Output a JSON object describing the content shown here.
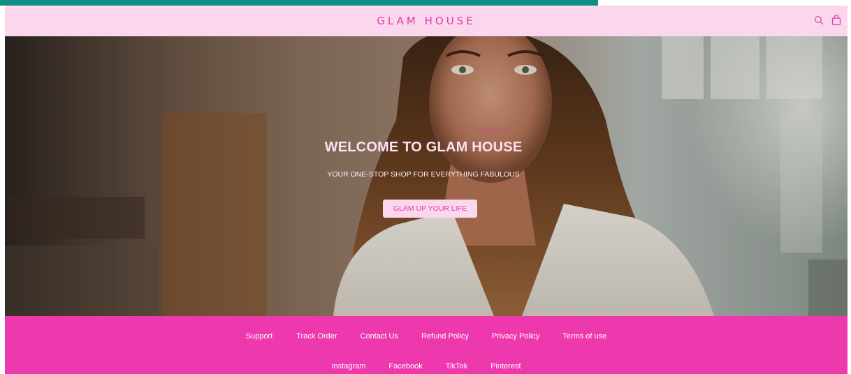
{
  "header": {
    "logo": "GLAM HOUSE",
    "icons": [
      "search-icon",
      "shopping-bag-icon"
    ]
  },
  "hero": {
    "title": "WELCOME TO GLAM HOUSE",
    "subtitle": "YOUR ONE-STOP SHOP FOR EVERYTHING FABULOUS",
    "cta_label": "GLAM UP YOUR LIFE"
  },
  "footer": {
    "links": [
      "Support",
      "Track Order",
      "Contact Us",
      "Refund Policy",
      "Privacy Policy",
      "Terms of use"
    ],
    "social": [
      "Instagram",
      "Facebook",
      "TikTok",
      "Pinterest"
    ]
  },
  "colors": {
    "header_bg": "#fbd7ee",
    "brand_pink": "#e23aa8",
    "footer_bg": "#ee38ad",
    "top_strip": "#0e8f86"
  }
}
